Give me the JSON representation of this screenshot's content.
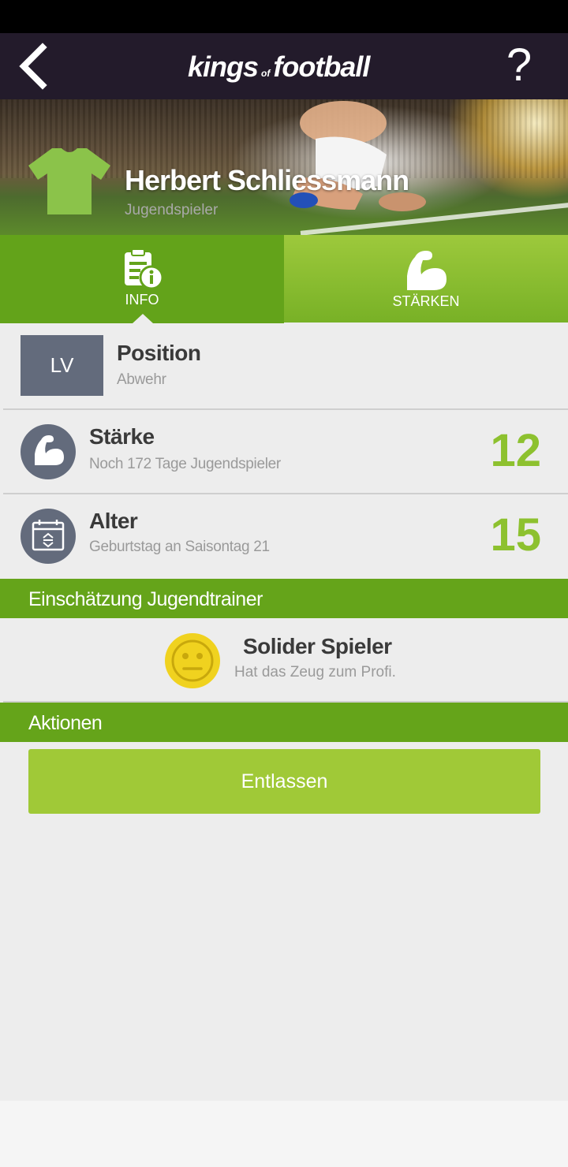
{
  "header": {
    "logo_word1": "kings",
    "logo_word2": "of",
    "logo_word3": "football",
    "help_label": "?"
  },
  "player": {
    "name": "Herbert Schliessmann",
    "role": "Jugendspieler",
    "jersey_color": "#8bc34a"
  },
  "tabs": [
    {
      "label": "INFO",
      "icon": "info-document-icon",
      "active": true
    },
    {
      "label": "STÄRKEN",
      "icon": "flexed-biceps-icon",
      "active": false
    }
  ],
  "info": {
    "position": {
      "badge": "LV",
      "title": "Position",
      "subtitle": "Abwehr"
    },
    "strength": {
      "title": "Stärke",
      "subtitle": "Noch 172 Tage Jugendspieler",
      "value": "12",
      "icon": "flexed-biceps-icon"
    },
    "age": {
      "title": "Alter",
      "subtitle": "Geburtstag an Saisontag 21",
      "value": "15",
      "icon": "calendar-icon"
    }
  },
  "evaluation": {
    "section_title": "Einschätzung Jugendtrainer",
    "title": "Solider Spieler",
    "subtitle": "Hat das Zeug zum Profi.",
    "icon": "neutral-smiley-icon"
  },
  "actions": {
    "section_title": "Aktionen",
    "fire_label": "Entlassen"
  },
  "colors": {
    "header_bg": "#231b2b",
    "accent_green": "#65a41a",
    "value_green": "#8dc12f",
    "button_green": "#a0c937",
    "icon_slate": "#636b7c",
    "smiley_yellow": "#f0d21f"
  }
}
